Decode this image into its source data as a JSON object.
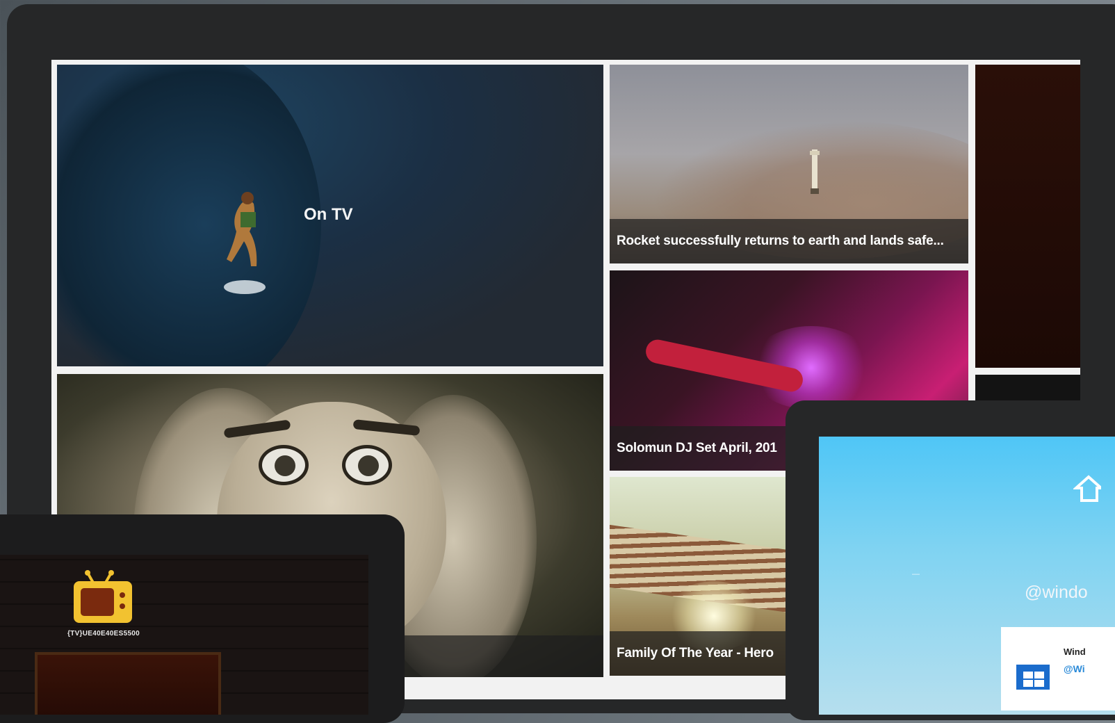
{
  "main_screen": {
    "featured_tile": {
      "label": "On TV"
    },
    "tiles": [
      {
        "caption": "Rocket successfully returns to earth and lands safe..."
      },
      {
        "caption": "Solomun DJ Set April, 201"
      },
      {
        "caption": "Family Of The Year - Hero"
      }
    ]
  },
  "left_device": {
    "logo_icon": "retro-tv-icon",
    "logo_text": "{TV}UE40E40ES5500"
  },
  "right_device": {
    "home_icon": "home-icon",
    "twitter_handle": "@windo",
    "card": {
      "name": "Wind",
      "handle": "@Wi"
    }
  },
  "colors": {
    "device_frame": "#262728",
    "caption_bg": "rgba(30,30,30,0.72)",
    "tv_logo_yellow": "#f2c230",
    "twitter_sky": "#4fc6f6",
    "card_handle": "#2a8ad8"
  }
}
